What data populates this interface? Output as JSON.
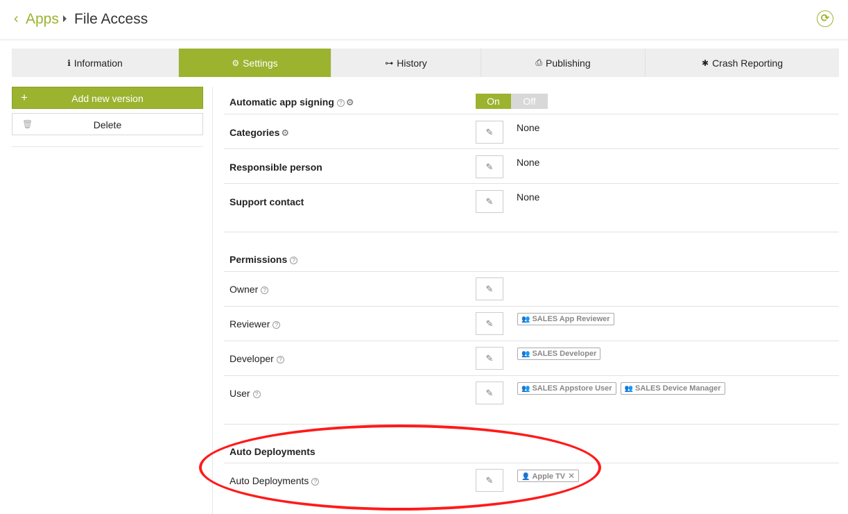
{
  "breadcrumb": {
    "back_icon": "‹",
    "parent": "Apps",
    "title": "File Access"
  },
  "refresh_icon": "refresh-icon",
  "tabs": [
    {
      "icon": "info-icon",
      "glyph": "ℹ",
      "label": "Information",
      "active": false
    },
    {
      "icon": "gear-icon",
      "glyph": "⚙",
      "label": "Settings",
      "active": true
    },
    {
      "icon": "history-icon",
      "glyph": "⊶",
      "label": "History",
      "active": false
    },
    {
      "icon": "publish-icon",
      "glyph": "⎙",
      "label": "Publishing",
      "active": false
    },
    {
      "icon": "bug-icon",
      "glyph": "✱",
      "label": "Crash Reporting",
      "active": false
    }
  ],
  "sidebar": {
    "add_label": "Add new version",
    "delete_label": "Delete"
  },
  "settings": {
    "signing": {
      "label": "Automatic app signing",
      "on": "On",
      "off": "Off"
    },
    "categories": {
      "label": "Categories",
      "value": "None"
    },
    "responsible": {
      "label": "Responsible person",
      "value": "None"
    },
    "support": {
      "label": "Support contact",
      "value": "None"
    }
  },
  "permissions": {
    "heading": "Permissions",
    "owner": {
      "label": "Owner"
    },
    "reviewer": {
      "label": "Reviewer",
      "chips": [
        "SALES App Reviewer"
      ]
    },
    "developer": {
      "label": "Developer",
      "chips": [
        "SALES Developer"
      ]
    },
    "user": {
      "label": "User",
      "chips": [
        "SALES Appstore User",
        "SALES Device Manager"
      ]
    }
  },
  "auto_deployments": {
    "heading": "Auto Deployments",
    "label": "Auto Deployments",
    "chip": "Apple TV"
  },
  "colors": {
    "accent": "#9bb32f",
    "highlight": "#ff1a1a"
  }
}
